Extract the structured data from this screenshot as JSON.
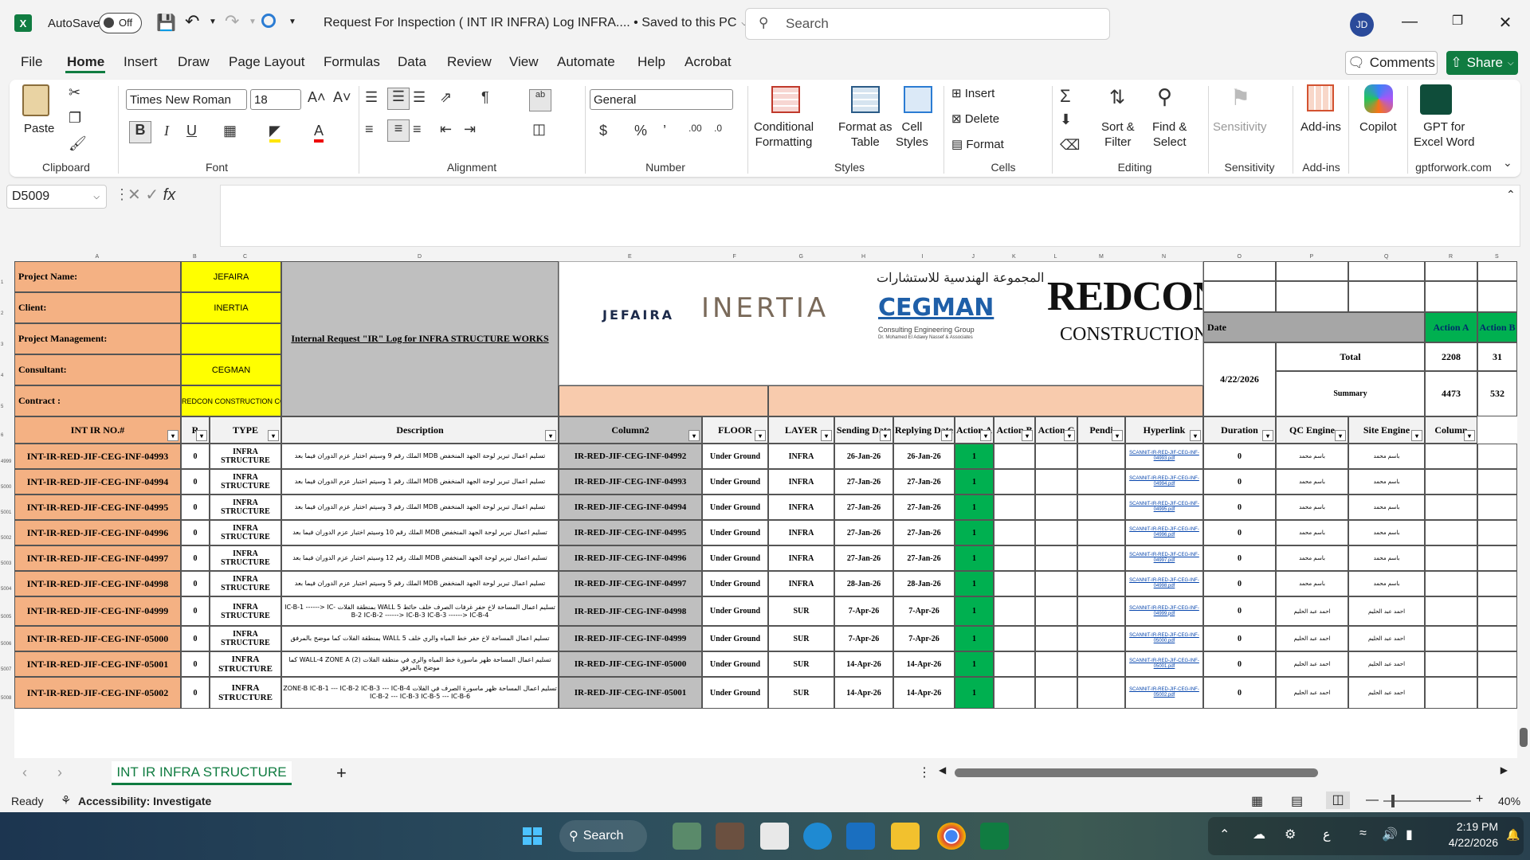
{
  "titlebar": {
    "autosave_label": "AutoSave",
    "autosave_state": "Off",
    "doc_title": "Request For Inspection (  INT IR INFRA) Log INFRA.... • Saved to this PC",
    "search_placeholder": "Search",
    "user_initials": "JD"
  },
  "menu": {
    "items": [
      "File",
      "Home",
      "Insert",
      "Draw",
      "Page Layout",
      "Formulas",
      "Data",
      "Review",
      "View",
      "Automate",
      "Help",
      "Acrobat"
    ],
    "comments_label": "Comments",
    "share_label": "Share"
  },
  "ribbon": {
    "paste_label": "Paste",
    "clipboard_label": "Clipboard",
    "font_name": "Times New Roman",
    "font_size": "18",
    "font_label": "Font",
    "alignment_label": "Alignment",
    "number_format": "General",
    "number_label": "Number",
    "conditional_formatting": "Conditional\nFormatting",
    "format_as_table": "Format as\nTable",
    "cell_styles": "Cell\nStyles",
    "styles_label": "Styles",
    "insert_label": "Insert",
    "delete_label": "Delete",
    "format_label": "Format",
    "cells_label": "Cells",
    "sort_filter": "Sort &\nFilter",
    "find_select": "Find &\nSelect",
    "editing_label": "Editing",
    "sensitivity_btn": "Sensitivity",
    "sensitivity_label": "Sensitivity",
    "addins_btn": "Add-ins",
    "addins_label": "Add-ins",
    "copilot_btn": "Copilot",
    "gpt_btn": "GPT for\nExcel Word",
    "gpt_label": "gptforwork.com"
  },
  "formula_bar": {
    "name_box": "D5009",
    "fx": "fx",
    "formula": ""
  },
  "sheet": {
    "column_letters": [
      "A",
      "B",
      "C",
      "D",
      "E",
      "F",
      "G",
      "H",
      "I",
      "J",
      "K",
      "L",
      "M",
      "N",
      "O",
      "P",
      "Q",
      "R",
      "S"
    ],
    "row_numbers": [
      "1",
      "2",
      "3",
      "4",
      "5",
      "6",
      "4999",
      "5000",
      "5001",
      "5002",
      "5003",
      "5004",
      "5005",
      "5006",
      "5007",
      "5008"
    ],
    "labels": {
      "project_name": "Project Name:",
      "client": "Client:",
      "project_management": "Project Management:",
      "consultant": "Consultant:",
      "contract": "Contract :"
    },
    "values": {
      "project_name": "JEFAIRA",
      "client": "INERTIA",
      "project_management": "",
      "consultant": "CEGMAN",
      "contract": "REDCON CONSTRUCTION CO"
    },
    "log_title": "Internal Request \"IR\" Log for INFRA STRUCTURE WORKS",
    "logos": {
      "jefaira": "JEFAIRA",
      "inertia": "INERTIA",
      "cegman_arabic": "المجموعة الهندسية للاستشارات",
      "cegman": "CEGMAN",
      "cegman_sub": "Consulting Engineering Group",
      "cegman_sub2": "Dr. Mohamed El Adawy Nassef & Associates",
      "redcon": "REDCON",
      "redcon_sub": "CONSTRUCTION"
    },
    "summary": {
      "date_label": "Date",
      "action_a": "Action A",
      "action_b": "Action B",
      "date_value": "4/22/2026",
      "total_label": "Total",
      "total_a": "2208",
      "total_b": "31",
      "summary_label": "Summary",
      "summary_a": "4473",
      "summary_b": "532"
    },
    "headers": [
      "INT IR NO.#",
      "R",
      "TYPE",
      "Description",
      "Column2",
      "FLOOR",
      "LAYER",
      "Sending Date",
      "Replying Date",
      "Action A",
      "Action B",
      "Action C",
      "Pendi",
      "Hyperlink",
      "Duration",
      "QC Engine",
      "Site Engine",
      "Column"
    ],
    "rows": [
      {
        "no": "INT-IR-RED-JIF-CEG-INF-04993",
        "r": "0",
        "type": "INFRA STRUCTURE",
        "desc": "تسليم اعمال تبرير لوحة الجهد المنخفض MDB الملك رقم 9 وسيتم اختبار عزم الدوران فيما بعد",
        "col2": "IR-RED-JIF-CEG-INF-04992",
        "floor": "Under Ground",
        "layer": "INFRA",
        "send": "26-Jan-26",
        "reply": "26-Jan-26",
        "a": "1",
        "link": "SCANNIT-IR-RED-JIF-CEG-INF-04993.pdf",
        "dur": "0",
        "qc": "باسم محمد",
        "site": "باسم محمد"
      },
      {
        "no": "INT-IR-RED-JIF-CEG-INF-04994",
        "r": "0",
        "type": "INFRA STRUCTURE",
        "desc": "تسليم اعمال تبرير لوحة الجهد المنخفض MDB الملك رقم 1 وسيتم اختبار عزم الدوران فيما بعد",
        "col2": "IR-RED-JIF-CEG-INF-04993",
        "floor": "Under Ground",
        "layer": "INFRA",
        "send": "27-Jan-26",
        "reply": "27-Jan-26",
        "a": "1",
        "link": "SCANNIT-IR-RED-JIF-CEG-INF-04994.pdf",
        "dur": "0",
        "qc": "باسم محمد",
        "site": "باسم محمد"
      },
      {
        "no": "INT-IR-RED-JIF-CEG-INF-04995",
        "r": "0",
        "type": "INFRA STRUCTURE",
        "desc": "تسليم اعمال تبرير لوحة الجهد المنخفض MDB الملك رقم 3 وسيتم اختبار عزم الدوران فيما بعد",
        "col2": "IR-RED-JIF-CEG-INF-04994",
        "floor": "Under Ground",
        "layer": "INFRA",
        "send": "27-Jan-26",
        "reply": "27-Jan-26",
        "a": "1",
        "link": "SCANNIT-IR-RED-JIF-CEG-INF-04995.pdf",
        "dur": "0",
        "qc": "باسم محمد",
        "site": "باسم محمد"
      },
      {
        "no": "INT-IR-RED-JIF-CEG-INF-04996",
        "r": "0",
        "type": "INFRA STRUCTURE",
        "desc": "تسليم اعمال تبرير لوحة الجهد المنخفض MDB الملك رقم 10 وسيتم اختبار عزم الدوران فيما بعد",
        "col2": "IR-RED-JIF-CEG-INF-04995",
        "floor": "Under Ground",
        "layer": "INFRA",
        "send": "27-Jan-26",
        "reply": "27-Jan-26",
        "a": "1",
        "link": "SCANNIT-IR-RED-JIF-CEG-INF-04996.pdf",
        "dur": "0",
        "qc": "باسم محمد",
        "site": "باسم محمد"
      },
      {
        "no": "INT-IR-RED-JIF-CEG-INF-04997",
        "r": "0",
        "type": "INFRA STRUCTURE",
        "desc": "تسليم اعمال تبرير لوحة الجهد المنخفض MDB الملك رقم 12 وسيتم اختبار عزم الدوران فيما بعد",
        "col2": "IR-RED-JIF-CEG-INF-04996",
        "floor": "Under Ground",
        "layer": "INFRA",
        "send": "27-Jan-26",
        "reply": "27-Jan-26",
        "a": "1",
        "link": "SCANNIT-IR-RED-JIF-CEG-INF-04997.pdf",
        "dur": "0",
        "qc": "باسم محمد",
        "site": "باسم محمد"
      },
      {
        "no": "INT-IR-RED-JIF-CEG-INF-04998",
        "r": "0",
        "type": "INFRA STRUCTURE",
        "desc": "تسليم اعمال تبرير لوحة الجهد المنخفض MDB الملك رقم 5 وسيتم اختبار عزم الدوران فيما بعد",
        "col2": "IR-RED-JIF-CEG-INF-04997",
        "floor": "Under Ground",
        "layer": "INFRA",
        "send": "28-Jan-26",
        "reply": "28-Jan-26",
        "a": "1",
        "link": "SCANNIT-IR-RED-JIF-CEG-INF-04998.pdf",
        "dur": "0",
        "qc": "باسم محمد",
        "site": "باسم محمد"
      },
      {
        "no": "INT-IR-RED-JIF-CEG-INF-04999",
        "r": "0",
        "type": "INFRA STRUCTURE",
        "desc": "تسليم اعمال المساحة لاخ حفر غرفات الصرف خلف حائط WALL 5 بمنطقة الفلات IC-B-1 ------> IC-B-2 IC-B-2 ------> IC-B-3 IC-B-3 ------> IC-B-4",
        "col2": "IR-RED-JIF-CEG-INF-04998",
        "floor": "Under Ground",
        "layer": "SUR",
        "send": "7-Apr-26",
        "reply": "7-Apr-26",
        "a": "1",
        "link": "SCANNIT-IR-RED-JIF-CEG-INF-04999.pdf",
        "dur": "0",
        "qc": "احمد عبد الحليم",
        "site": "احمد عبد الحليم"
      },
      {
        "no": "INT-IR-RED-JIF-CEG-INF-05000",
        "r": "0",
        "type": "INFRA STRUCTURE",
        "desc": "تسليم اعمال المساحة لاخ حفر خط المياه والري خلف WALL 5 بمنطقة الفلات كما موضح بالمرفق",
        "col2": "IR-RED-JIF-CEG-INF-04999",
        "floor": "Under Ground",
        "layer": "SUR",
        "send": "7-Apr-26",
        "reply": "7-Apr-26",
        "a": "1",
        "link": "SCANNIT-IR-RED-JIF-CEG-INF-05000.pdf",
        "dur": "0",
        "qc": "احمد عبد الحليم",
        "site": "احمد عبد الحليم"
      },
      {
        "no": "INT-IR-RED-JIF-CEG-INF-05001",
        "r": "0",
        "type": "INFRA STRUCTURE",
        "desc": "تسليم اعمال المساحة ظهر ماسورة خط المياه والري في منطقة الفلات (2) WALL-4 ZONE A كما موضح بالمرفق",
        "col2": "IR-RED-JIF-CEG-INF-05000",
        "floor": "Under Ground",
        "layer": "SUR",
        "send": "14-Apr-26",
        "reply": "14-Apr-26",
        "a": "1",
        "link": "SCANNIT-IR-RED-JIF-CEG-INF-05001.pdf",
        "dur": "0",
        "qc": "احمد عبد الحليم",
        "site": "احمد عبد الحليم"
      },
      {
        "no": "INT-IR-RED-JIF-CEG-INF-05002",
        "r": "0",
        "type": "INFRA STRUCTURE",
        "desc": "تسليم اعمال المساحة ظهر ماسورة الصرف في الفلات ZONE-B IC-B-1 --- IC-B-2 IC-B-3 --- IC-B-4 IC-B-2 --- IC-B-3 IC-B-5 --- IC-B-6",
        "col2": "IR-RED-JIF-CEG-INF-05001",
        "floor": "Under Ground",
        "layer": "SUR",
        "send": "14-Apr-26",
        "reply": "14-Apr-26",
        "a": "1",
        "link": "SCANNIT-IR-RED-JIF-CEG-INF-05002.pdf",
        "dur": "0",
        "qc": "احمد عبد الحليم",
        "site": "احمد عبد الحليم"
      }
    ]
  },
  "tabs": {
    "active_sheet": "INT IR INFRA STRUCTURE",
    "add_label": "+"
  },
  "status": {
    "ready": "Ready",
    "accessibility": "Accessibility: Investigate",
    "zoom": "40%"
  },
  "taskbar": {
    "search_label": "Search",
    "time": "2:19 PM",
    "date": "4/22/2026",
    "lang": "ع"
  },
  "colors": {
    "excel_green": "#107c41",
    "label_orange": "#f4b183",
    "value_yellow": "#ffff00",
    "action_green": "#00b050"
  }
}
